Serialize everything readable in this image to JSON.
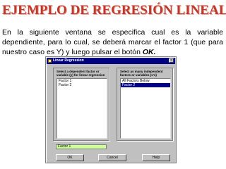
{
  "slide": {
    "title": "EJEMPLO DE REGRESIÓN LINEAL",
    "text_part1": "En la siguiente ventana se especifica cual es la variable dependiente, para lo cual, se deberá marcar el factor 1 (que para nuestro caso es Y) y luego pulsar el botón ",
    "text_bold": "OK.",
    "colors": {
      "title": "#c0382b",
      "window_bg": "#c0c0c0",
      "selection": "#000080",
      "target_field": "#ccff99"
    }
  },
  "window": {
    "title": "Linear Regression",
    "close_label": "×",
    "dependent": {
      "label": "Select a dependent factor or variable (y) for linear regression",
      "items": [
        "Factor 1",
        "Factor 2"
      ],
      "selected_index": 0,
      "field_value": "Factor 1"
    },
    "independent": {
      "label": "Select as many independent factors or variables (x's)",
      "items": [
        "All Factors Below",
        "Factor 2"
      ],
      "selected_index": 1
    },
    "buttons": {
      "ok": "OK",
      "cancel": "Cancel",
      "help": "Help"
    }
  }
}
